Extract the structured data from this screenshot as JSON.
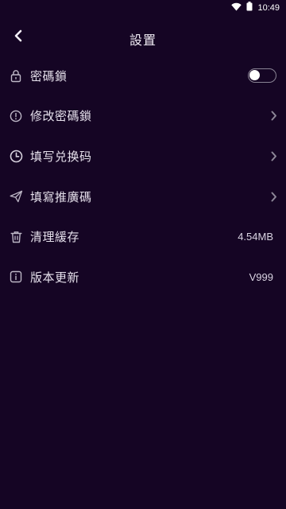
{
  "status_bar": {
    "time": "10:49",
    "icons": [
      "wifi-icon",
      "battery-icon"
    ]
  },
  "header": {
    "title": "設置",
    "back_icon": "chevron-left-icon"
  },
  "settings": [
    {
      "label": "密碼鎖",
      "icon": "lock-icon",
      "control": "toggle",
      "toggle_on": false
    },
    {
      "label": "修改密碼鎖",
      "icon": "info-circle-icon",
      "control": "chevron"
    },
    {
      "label": "填写兑换码",
      "icon": "clock-icon",
      "control": "chevron"
    },
    {
      "label": "填寫推廣碼",
      "icon": "paper-plane-icon",
      "control": "chevron"
    },
    {
      "label": "清理緩存",
      "icon": "trash-icon",
      "control": "value",
      "value": "4.54MB"
    },
    {
      "label": "版本更新",
      "icon": "info-square-icon",
      "control": "value",
      "value": "V999"
    }
  ],
  "colors": {
    "background": "#150524",
    "text": "#e6e1ec",
    "icon": "#bdb7c6",
    "chevron": "#8d8798"
  }
}
